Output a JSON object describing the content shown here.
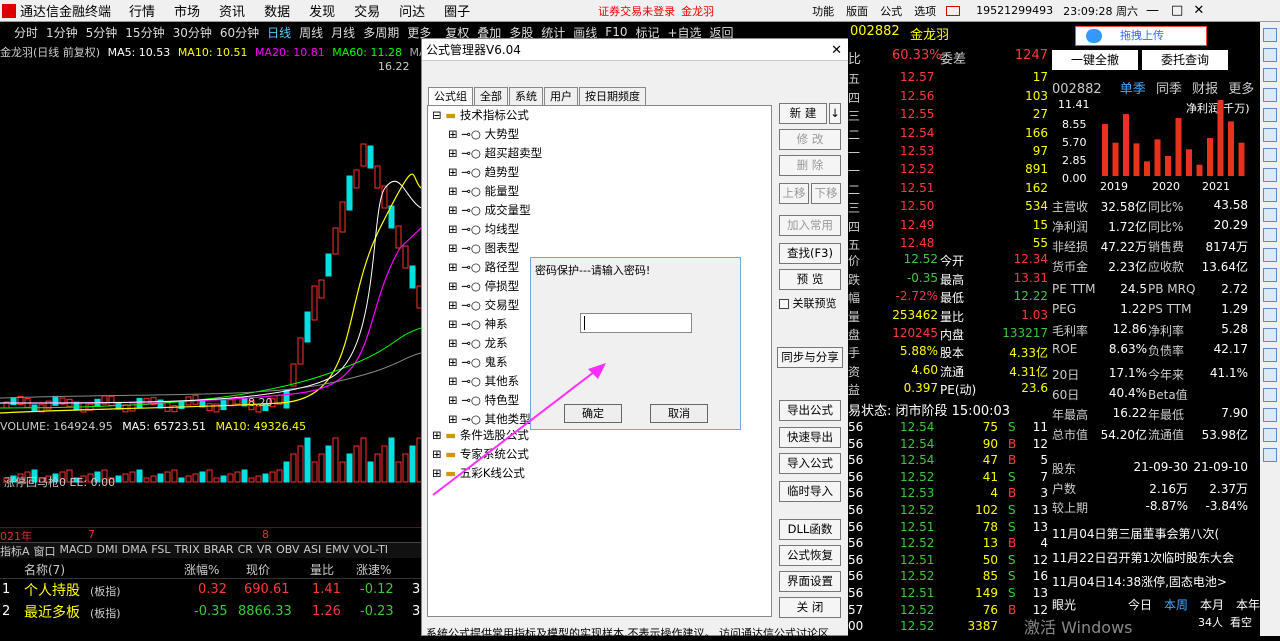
{
  "menubar": {
    "app": "通达信金融终端",
    "items": [
      "行情",
      "市场",
      "资讯",
      "数据",
      "发现",
      "交易",
      "问达",
      "圈子"
    ],
    "warning": "证券交易未登录",
    "stock": "金龙羽",
    "right_items": [
      "功能",
      "版面",
      "公式",
      "选项"
    ],
    "phone": "19521299493",
    "time": "23:09:28 周六"
  },
  "periods": [
    "分时",
    "1分钟",
    "5分钟",
    "15分钟",
    "30分钟",
    "60分钟",
    "日线",
    "周线",
    "月线",
    "多周期",
    "更多"
  ],
  "toolbar": [
    "复权",
    "叠加",
    "多股",
    "统计",
    "画线",
    "F10",
    "标记",
    "+自选",
    "返回"
  ],
  "chart": {
    "title": "金龙羽(日线 前复权)",
    "ma5": "MA5: 10.53",
    "ma10": "MA10: 10.51",
    "ma20": "MA20: 10.81",
    "ma60": "MA60: 11.28",
    "ma120": "MA12",
    "high": "16.22",
    "low": "8.20",
    "volume": "VOLUME: 164924.95",
    "vma5": "MA5: 65723.51",
    "vma10": "MA10: 49326.45",
    "ind": "涨停回马枪0 EE: 0.00",
    "year": "021年",
    "m7": "7",
    "m8": "8"
  },
  "bottom_tabs": [
    "指标A",
    "窗口",
    "MACD",
    "DMI",
    "DMA",
    "FSL",
    "TRIX",
    "BRAR",
    "CR",
    "VR",
    "OBV",
    "ASI",
    "EMV",
    "VOL-TI"
  ],
  "list_header": [
    "名称(7)",
    "涨幅%",
    "现价",
    "量比",
    "涨速%"
  ],
  "list_rows": [
    {
      "n": "1",
      "name": "个人持股",
      "tag": "(板指)",
      "chg": "0.32",
      "price": "690.61",
      "vr": "1.41",
      "sp": "-0.12",
      "x": "3"
    },
    {
      "n": "2",
      "name": "最近多板",
      "tag": "(板指)",
      "chg": "-0.35",
      "price": "8866.33",
      "vr": "1.26",
      "sp": "-0.23",
      "x": "3"
    }
  ],
  "dialog": {
    "title": "公式管理器V6.04",
    "tabs": [
      "公式组",
      "全部",
      "系统",
      "用户",
      "按日期频度"
    ],
    "root": "技术指标公式",
    "children": [
      "大势型",
      "超买超卖型",
      "趋势型",
      "能量型",
      "成交量型",
      "均线型",
      "图表型",
      "路径型",
      "停损型",
      "交易型",
      "神系",
      "龙系",
      "鬼系",
      "其他系",
      "特色型",
      "其他类型"
    ],
    "others": [
      "条件选股公式",
      "专家系统公式",
      "五彩K线公式"
    ],
    "buttons": [
      "新 建",
      "修 改",
      "删 除",
      "加入常用",
      "查找(F3)",
      "预 览",
      "同步与分享",
      "导出公式",
      "快速导出",
      "导入公式",
      "临时导入",
      "DLL函数",
      "公式恢复",
      "界面设置",
      "关 闭"
    ],
    "up": "上移",
    "down": "下移",
    "check": "关联预览",
    "status": "系统公式提供常用指标及模型的实现样本,不表示操作建议。 访问通达信公式讨论区",
    "pw_title": "密码保护---请输入密码!",
    "ok": "确定",
    "cancel": "取消"
  },
  "quote": {
    "code": "002882",
    "name": "金龙羽",
    "ratio": "60.33%",
    "ratio_lbl": "委差",
    "ratio_val": "1247",
    "sell": [
      [
        "12.57",
        "17"
      ],
      [
        "12.56",
        "103"
      ],
      [
        "12.55",
        "27"
      ],
      [
        "12.54",
        "166"
      ],
      [
        "12.53",
        "97"
      ]
    ],
    "buy": [
      [
        "12.52",
        "891"
      ],
      [
        "12.51",
        "162"
      ],
      [
        "12.50",
        "534"
      ],
      [
        "12.49",
        "15"
      ],
      [
        "12.48",
        "55"
      ]
    ],
    "sell_lbl": [
      "五",
      "四",
      "三",
      "二",
      "一"
    ],
    "buy_lbl": [
      "一",
      "二",
      "三",
      "四",
      "五"
    ],
    "stats": [
      [
        "12.52",
        "今开",
        "12.34"
      ],
      [
        "-0.35",
        "最高",
        "13.31"
      ],
      [
        "-2.72%",
        "最低",
        "12.22"
      ],
      [
        "253462",
        "量比",
        "1.03"
      ],
      [
        "120245",
        "内盘",
        "133217"
      ]
    ],
    "stats_lbl": [
      "价",
      "跌",
      "幅",
      "量",
      "盘"
    ],
    "cap": [
      [
        "5.88%",
        "股本",
        "4.33亿"
      ],
      [
        "4.60",
        "流通",
        "4.31亿"
      ],
      [
        "0.397",
        "PE(动)",
        "23.6"
      ]
    ],
    "cap_lbl": [
      "手",
      "资",
      "益"
    ],
    "status": "易状态: 闭市阶段 15:00:03",
    "ticks": [
      [
        "56",
        "12.54",
        "75",
        "S",
        "11"
      ],
      [
        "56",
        "12.54",
        "90",
        "B",
        "12"
      ],
      [
        "56",
        "12.54",
        "47",
        "B",
        "5"
      ],
      [
        "56",
        "12.52",
        "41",
        "S",
        "7"
      ],
      [
        "56",
        "12.53",
        "4",
        "B",
        "3"
      ],
      [
        "56",
        "12.52",
        "102",
        "S",
        "13"
      ],
      [
        "56",
        "12.51",
        "78",
        "S",
        "13"
      ],
      [
        "56",
        "12.52",
        "13",
        "B",
        "4"
      ],
      [
        "56",
        "12.51",
        "50",
        "S",
        "12"
      ],
      [
        "56",
        "12.52",
        "85",
        "S",
        "16"
      ],
      [
        "56",
        "12.51",
        "149",
        "S",
        "13"
      ],
      [
        "57",
        "12.52",
        "76",
        "B",
        "12"
      ],
      [
        "00",
        "12.52",
        "3387",
        "",
        ""
      ]
    ]
  },
  "fin": {
    "upload": "拖拽上传",
    "login": "一键全撤",
    "cancel": "委托查询",
    "code": "002882",
    "tabs": [
      "单季",
      "同季",
      "财报",
      "更多"
    ],
    "y": [
      "11.41",
      "8.55",
      "5.70",
      "2.85",
      "0.00"
    ],
    "net": "净利润(千万)",
    "years": [
      "2019",
      "2020",
      "2021"
    ],
    "bars": [
      7.8,
      5.0,
      9.3,
      4.9,
      2.2,
      5.5,
      3.0,
      8.7,
      4.0,
      1.7,
      5.7,
      11.4,
      8.2,
      5.0
    ],
    "rows": [
      [
        "主营收",
        "32.58亿",
        "同比%",
        "43.58"
      ],
      [
        "净利润",
        "1.72亿",
        "同比%",
        "20.29"
      ],
      [
        "非经损",
        "47.22万",
        "销售费",
        "8174万"
      ],
      [
        "货币金",
        "2.23亿",
        "应收款",
        "13.64亿"
      ],
      [
        "PE TTM",
        "24.5",
        "PB MRQ",
        "2.72"
      ],
      [
        "PEG",
        "1.22",
        "PS TTM",
        "1.29"
      ],
      [
        "毛利率",
        "12.86",
        "净利率",
        "5.28"
      ],
      [
        "ROE",
        "8.63%",
        "负债率",
        "42.17"
      ],
      [
        "20日",
        "17.1%",
        "今年来",
        "41.1%"
      ],
      [
        "60日",
        "40.4%",
        "Beta值",
        ""
      ],
      [
        "年最高",
        "16.22",
        "年最低",
        "7.90"
      ],
      [
        "总市值",
        "54.20亿",
        "流通值",
        "53.98亿"
      ]
    ],
    "sh": [
      [
        "股东",
        "21-09-30",
        "21-09-10"
      ],
      [
        "户数",
        "2.16万",
        "2.37万"
      ],
      [
        "较上期",
        "-8.87%",
        "-3.84%"
      ]
    ],
    "news": [
      "11月04日第三届董事会第八次(",
      "11月22日召开第1次临时股东大会",
      "11月04日14:38涨停,固态电池>"
    ],
    "foot": [
      "眼光",
      "今日",
      "本周",
      "本月",
      "本年"
    ],
    "foot2": "34人",
    "foot3": "看空",
    "watermark": "激活 Windows"
  }
}
